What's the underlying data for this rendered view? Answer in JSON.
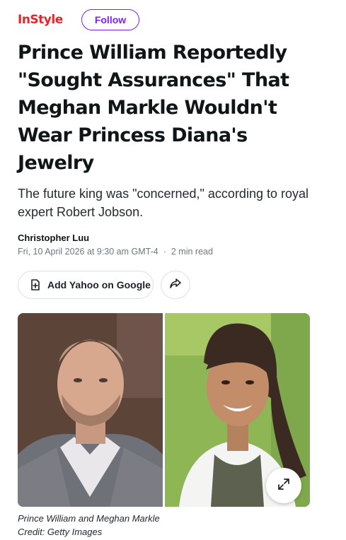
{
  "header": {
    "brand": "InStyle",
    "follow_label": "Follow"
  },
  "article": {
    "headline": "Prince William Reportedly \"Sought Assurances\" That Meghan Markle Wouldn't Wear Princess Diana's Jewelry",
    "subheadline": "The future king was \"concerned,\" according to royal expert Robert Jobson.",
    "author": "Christopher Luu",
    "published": "Fri, 10 April 2026 at 9:30 am GMT-4",
    "read_time": "2 min read"
  },
  "actions": {
    "add_label": "Add Yahoo on Google",
    "add_icon": "add-document-icon",
    "share_icon": "share-arrow-icon"
  },
  "image": {
    "caption_line1": "Prince William and Meghan Markle",
    "caption_line2": "Credit: Getty Images",
    "expand_icon": "expand-icon"
  },
  "colors": {
    "brand_red": "#e3262b",
    "follow_purple": "#7e1fff"
  }
}
